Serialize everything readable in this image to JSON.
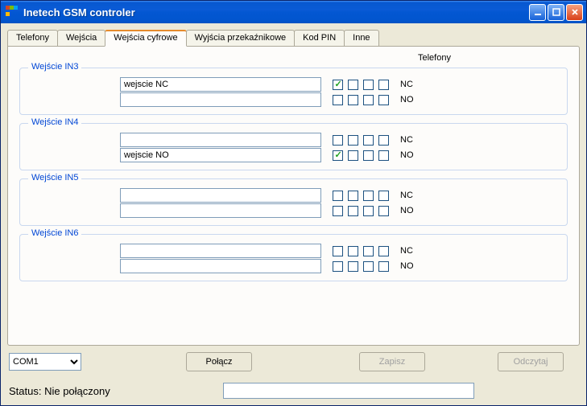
{
  "window": {
    "title": "Inetech GSM controler"
  },
  "tabs": [
    "Telefony",
    "Wejścia",
    "Wejścia cyfrowe",
    "Wyjścia przekaźnikowe",
    "Kod PIN",
    "Inne"
  ],
  "active_tab_index": 2,
  "panel": {
    "columns_header": "Telefony",
    "groups": [
      {
        "legend": "Wejście IN3",
        "rows": [
          {
            "value": "wejscie NC",
            "checks": [
              true,
              false,
              false,
              false
            ],
            "label": "NC"
          },
          {
            "value": "",
            "checks": [
              false,
              false,
              false,
              false
            ],
            "label": "NO"
          }
        ]
      },
      {
        "legend": "Wejście IN4",
        "rows": [
          {
            "value": "",
            "checks": [
              false,
              false,
              false,
              false
            ],
            "label": "NC"
          },
          {
            "value": "wejscie NO",
            "checks": [
              true,
              false,
              false,
              false
            ],
            "label": "NO"
          }
        ]
      },
      {
        "legend": "Wejście IN5",
        "rows": [
          {
            "value": "",
            "checks": [
              false,
              false,
              false,
              false
            ],
            "label": "NC"
          },
          {
            "value": "",
            "checks": [
              false,
              false,
              false,
              false
            ],
            "label": "NO"
          }
        ]
      },
      {
        "legend": "Wejście IN6",
        "rows": [
          {
            "value": "",
            "checks": [
              false,
              false,
              false,
              false
            ],
            "label": "NC"
          },
          {
            "value": "",
            "checks": [
              false,
              false,
              false,
              false
            ],
            "label": "NO"
          }
        ]
      }
    ]
  },
  "bottom": {
    "port_options": [
      "COM1"
    ],
    "port_selected": "COM1",
    "connect_label": "Połącz",
    "save_label": "Zapisz",
    "read_label": "Odczytaj"
  },
  "status": {
    "label": "Status: Nie połączony",
    "value": ""
  }
}
